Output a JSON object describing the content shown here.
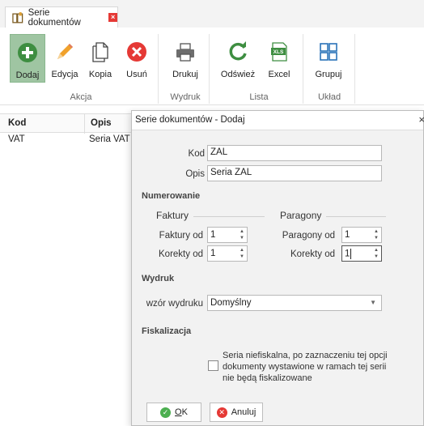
{
  "tab": {
    "title": "Serie dokumentów",
    "close": "×"
  },
  "ribbon": {
    "buttons": {
      "add": "Dodaj",
      "edit": "Edycja",
      "copy": "Kopia",
      "delete": "Usuń",
      "print": "Drukuj",
      "refresh": "Odśwież",
      "excel": "Excel",
      "group": "Grupuj"
    },
    "groups": {
      "action": "Akcja",
      "print": "Wydruk",
      "list": "Lista",
      "layout": "Układ"
    }
  },
  "grid": {
    "columns": [
      "Kod",
      "Opis"
    ],
    "rows": [
      {
        "kod": "VAT",
        "opis": "Seria VAT"
      }
    ]
  },
  "dialog": {
    "title": "Serie dokumentów - Dodaj",
    "close": "×",
    "kod_label": "Kod",
    "kod_value": "ZAL",
    "opis_label": "Opis",
    "opis_value": "Seria ZAL",
    "numbering_section": "Numerowanie",
    "invoices_title": "Faktury",
    "receipts_title": "Paragony",
    "invoices_from_label": "Faktury od",
    "invoices_from_value": "1",
    "invoice_corrections_label": "Korekty od",
    "invoice_corrections_value": "1",
    "receipts_from_label": "Paragony od",
    "receipts_from_value": "1",
    "receipt_corrections_label": "Korekty od",
    "receipt_corrections_value": "1",
    "print_section": "Wydruk",
    "print_template_label": "wzór wydruku",
    "print_template_value": "Domyślny",
    "fiscal_section": "Fiskalizacja",
    "fiscal_checkbox_line1": "Seria niefiskalna, po zaznaczeniu tej opcji",
    "fiscal_checkbox_line2": "dokumenty wystawione w ramach tej serii",
    "fiscal_checkbox_line3": "nie będą fiskalizowane",
    "fiscal_checked": false,
    "ok_label_first": "O",
    "ok_label_rest": "K",
    "cancel_label": "Anuluj"
  },
  "colors": {
    "accent_green": "#4caf50",
    "active_bg": "#9fc5a2",
    "danger": "#e53935"
  }
}
